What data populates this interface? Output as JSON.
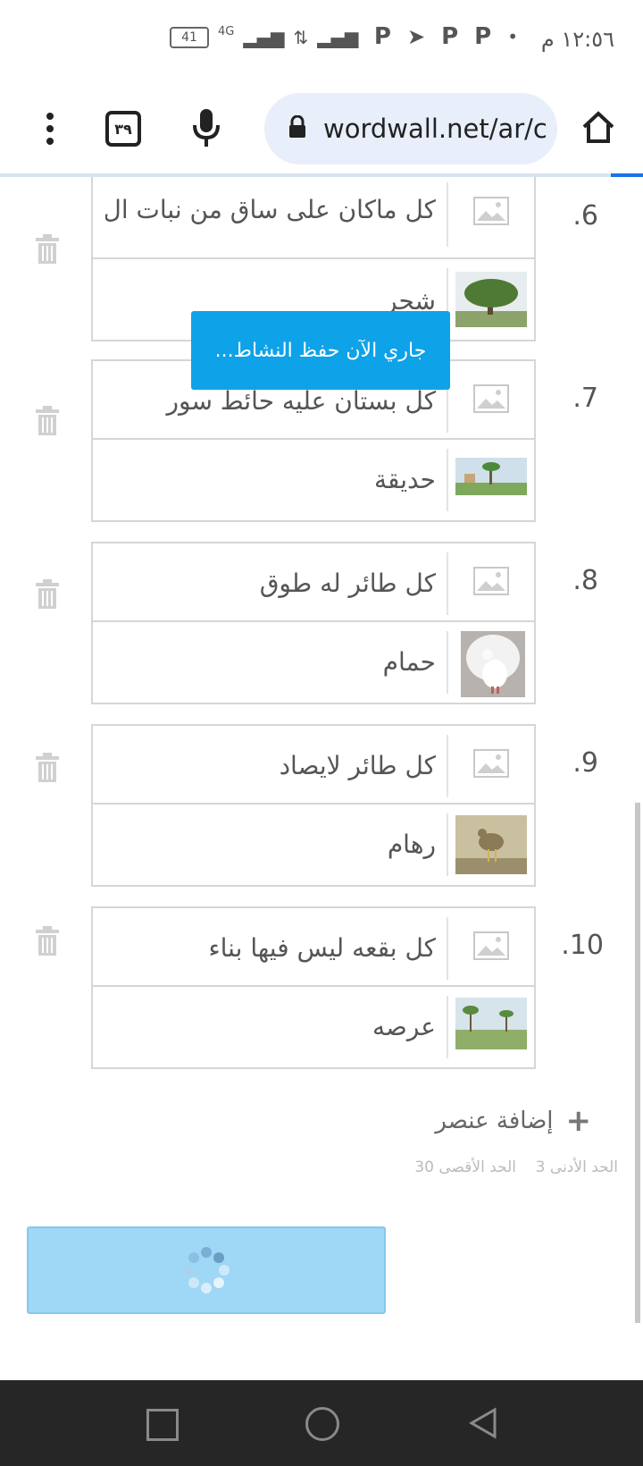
{
  "status_bar": {
    "time": "١٢:٥٦ م",
    "battery": "41",
    "network": "4G"
  },
  "browser": {
    "url": "wordwall.net/ar/c",
    "tabs_count": "٣٩"
  },
  "items": [
    {
      "number": ".6",
      "definition": "كل ماكان على ساق من نبات ال",
      "answer": "شجر"
    },
    {
      "number": ".7",
      "definition": "كل بستان عليه حائط سور",
      "answer": "حديقة"
    },
    {
      "number": ".8",
      "definition": "كل طائر له طوق",
      "answer": "حمام"
    },
    {
      "number": ".9",
      "definition": "كل طائر لايصاد",
      "answer": "رهام"
    },
    {
      "number": ".10",
      "definition": "كل بقعه ليس فيها بناء",
      "answer": "عرصه"
    }
  ],
  "add_item": {
    "label": "إضافة عنصر"
  },
  "limits": {
    "min_label": "الحد الأدنى",
    "min": "3",
    "max_label": "الحد الأقصى",
    "max": "30"
  },
  "toast": {
    "text": "جاري الآن حفظ النشاط..."
  },
  "icons": [
    "home-icon",
    "lock-icon",
    "mic-icon",
    "menu-icon",
    "image-placeholder-icon",
    "trash-icon",
    "plus-icon",
    "spinner-icon"
  ]
}
